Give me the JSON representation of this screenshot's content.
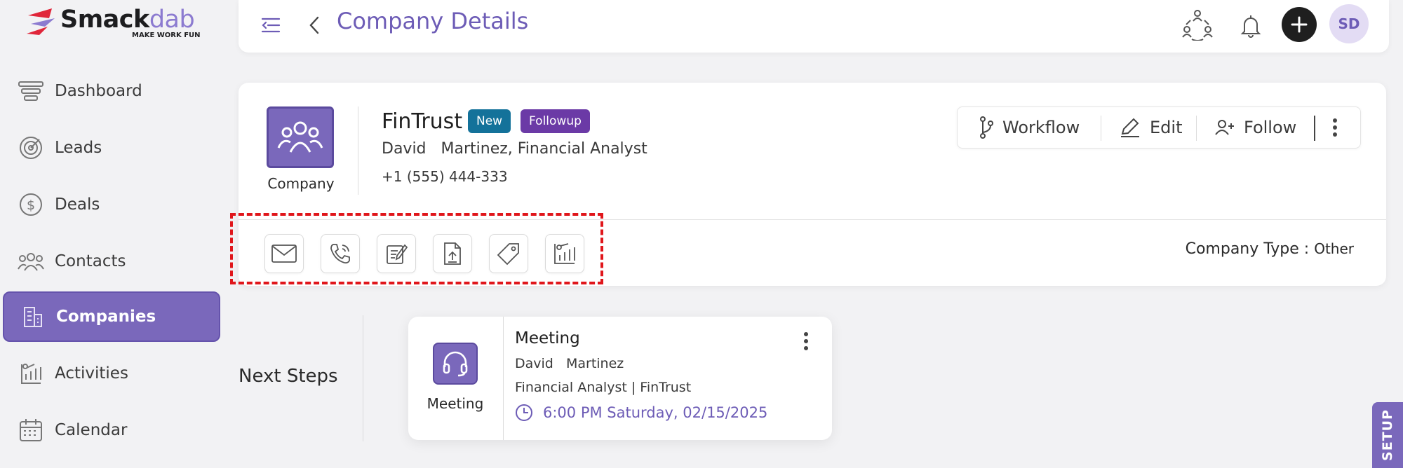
{
  "app": {
    "brand_name": "Smack",
    "brand_name_accent": "dab",
    "tagline": "MAKE WORK FUN"
  },
  "sidebar": {
    "items": [
      {
        "label": "Dashboard",
        "icon": "dashboard-icon"
      },
      {
        "label": "Leads",
        "icon": "target-icon"
      },
      {
        "label": "Deals",
        "icon": "dollar-icon"
      },
      {
        "label": "Contacts",
        "icon": "contacts-icon"
      },
      {
        "label": "Companies",
        "icon": "building-icon",
        "active": true
      },
      {
        "label": "Activities",
        "icon": "activities-icon"
      },
      {
        "label": "Calendar",
        "icon": "calendar-icon"
      }
    ]
  },
  "header": {
    "title": "Company Details",
    "avatar_initials": "SD"
  },
  "company": {
    "icon_label": "Company",
    "name": "FinTrust",
    "badges": [
      "New",
      "Followup"
    ],
    "contact": "David   Martinez, Financial Analyst",
    "phone": "+1 (555) 444-333",
    "type_label": "Company Type : ",
    "type_value": "Other",
    "actions": {
      "workflow": "Workflow",
      "edit": "Edit",
      "follow": "Follow"
    },
    "quick_actions": [
      "email-icon",
      "phone-icon",
      "note-icon",
      "upload-file-icon",
      "tag-icon",
      "activity-chart-icon"
    ]
  },
  "next_steps": {
    "label": "Next Steps",
    "meeting": {
      "icon_label": "Meeting",
      "title": "Meeting",
      "person": "David   Martinez",
      "role": "Financial Analyst | FinTrust",
      "datetime": "6:00 PM Saturday, 02/15/2025"
    }
  },
  "setup_tab": "SETUP",
  "colors": {
    "accent": "#7a68bb",
    "title": "#6d5cb6",
    "badge_new": "#14729a",
    "badge_followup": "#6b3aa6",
    "highlight": "#e0161b"
  }
}
